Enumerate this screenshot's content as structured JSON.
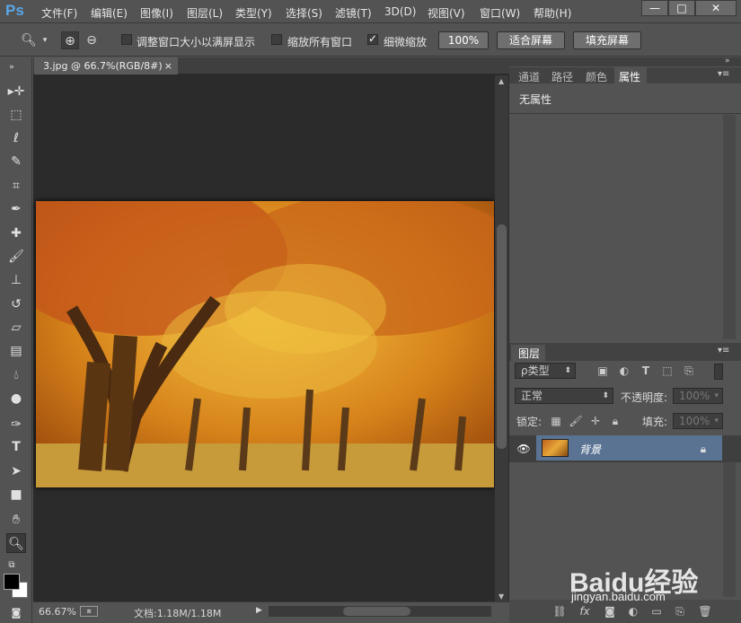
{
  "app": {
    "logo": "Ps"
  },
  "menu": [
    "文件(F)",
    "编辑(E)",
    "图像(I)",
    "图层(L)",
    "类型(Y)",
    "选择(S)",
    "滤镜(T)",
    "3D(D)",
    "视图(V)",
    "窗口(W)",
    "帮助(H)"
  ],
  "window_controls": {
    "minimize": "—",
    "maximize": "□",
    "close": "✕"
  },
  "options": {
    "resize_windows_label": "调整窗口大小以满屏显示",
    "resize_windows_checked": false,
    "zoom_all_label": "缩放所有窗口",
    "zoom_all_checked": false,
    "scrubby_zoom_label": "细微缩放",
    "scrubby_zoom_checked": true,
    "btn_100": "100%",
    "btn_fit": "适合屏幕",
    "btn_fill": "填充屏幕"
  },
  "document": {
    "tab_title": "3.jpg @ 66.7%(RGB/8#)",
    "tab_close": "×",
    "zoom": "66.67%",
    "doc_size": "文档:1.18M/1.18M"
  },
  "properties_panel": {
    "tabs": [
      "通道",
      "路径",
      "颜色",
      "属性"
    ],
    "active_tab": "属性",
    "content": "无属性"
  },
  "layers_panel": {
    "title": "图层",
    "filter_label": "ρ类型",
    "blend_mode": "正常",
    "opacity_label": "不透明度:",
    "opacity_value": "100%",
    "lock_label": "锁定:",
    "fill_label": "填充:",
    "fill_value": "100%",
    "layer_name": "背景"
  },
  "watermark": {
    "logo": "Baidu经验",
    "url": "jingyan.baidu.com"
  },
  "colors": {
    "selected_layer": "#5a7393",
    "ps_blue": "#5aa7e8"
  }
}
